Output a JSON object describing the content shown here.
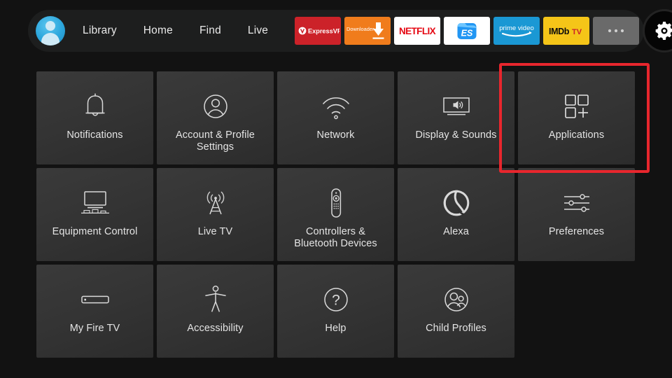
{
  "topnav": {
    "avatar": {
      "name": "profile-avatar"
    },
    "links": [
      {
        "label": "Library"
      },
      {
        "label": "Home"
      },
      {
        "label": "Find"
      },
      {
        "label": "Live"
      }
    ],
    "app_tiles": [
      {
        "name": "expressvpn",
        "label": "ExpressVPN",
        "bg": "#cc2229"
      },
      {
        "name": "downloader",
        "label": "Downloader",
        "bg": "#f07c1c"
      },
      {
        "name": "netflix",
        "label": "NETFLIX",
        "bg": "#ffffff"
      },
      {
        "name": "es-file-explorer",
        "label": "ES",
        "bg": "#ffffff"
      },
      {
        "name": "prime-video",
        "label": "prime video",
        "bg": "#1a98d4"
      },
      {
        "name": "imdb-tv",
        "label": "IMDb TV",
        "bg": "#f5c518"
      },
      {
        "name": "more-apps",
        "label": "...",
        "bg": "#6a6a6a"
      }
    ],
    "settings_button": {
      "label": "Settings",
      "icon": "gear-icon",
      "selected": true
    }
  },
  "grid": {
    "rows": [
      [
        {
          "label": "Notifications",
          "icon": "bell-icon"
        },
        {
          "label": "Account & Profile Settings",
          "icon": "person-circle-icon"
        },
        {
          "label": "Network",
          "icon": "wifi-icon"
        },
        {
          "label": "Display & Sounds",
          "icon": "tv-speaker-icon"
        },
        {
          "label": "Applications",
          "icon": "app-grid-plus-icon",
          "highlighted": true
        }
      ],
      [
        {
          "label": "Equipment Control",
          "icon": "tv-stand-icon"
        },
        {
          "label": "Live TV",
          "icon": "antenna-tower-icon"
        },
        {
          "label": "Controllers & Bluetooth Devices",
          "icon": "remote-icon"
        },
        {
          "label": "Alexa",
          "icon": "alexa-ring-icon"
        },
        {
          "label": "Preferences",
          "icon": "sliders-icon"
        }
      ],
      [
        {
          "label": "My Fire TV",
          "icon": "fire-tv-stick-icon"
        },
        {
          "label": "Accessibility",
          "icon": "accessibility-person-icon"
        },
        {
          "label": "Help",
          "icon": "question-circle-icon"
        },
        {
          "label": "Child Profiles",
          "icon": "two-people-icon"
        }
      ]
    ]
  },
  "annotation": {
    "highlight_color": "#e8262d",
    "target": "Applications"
  }
}
